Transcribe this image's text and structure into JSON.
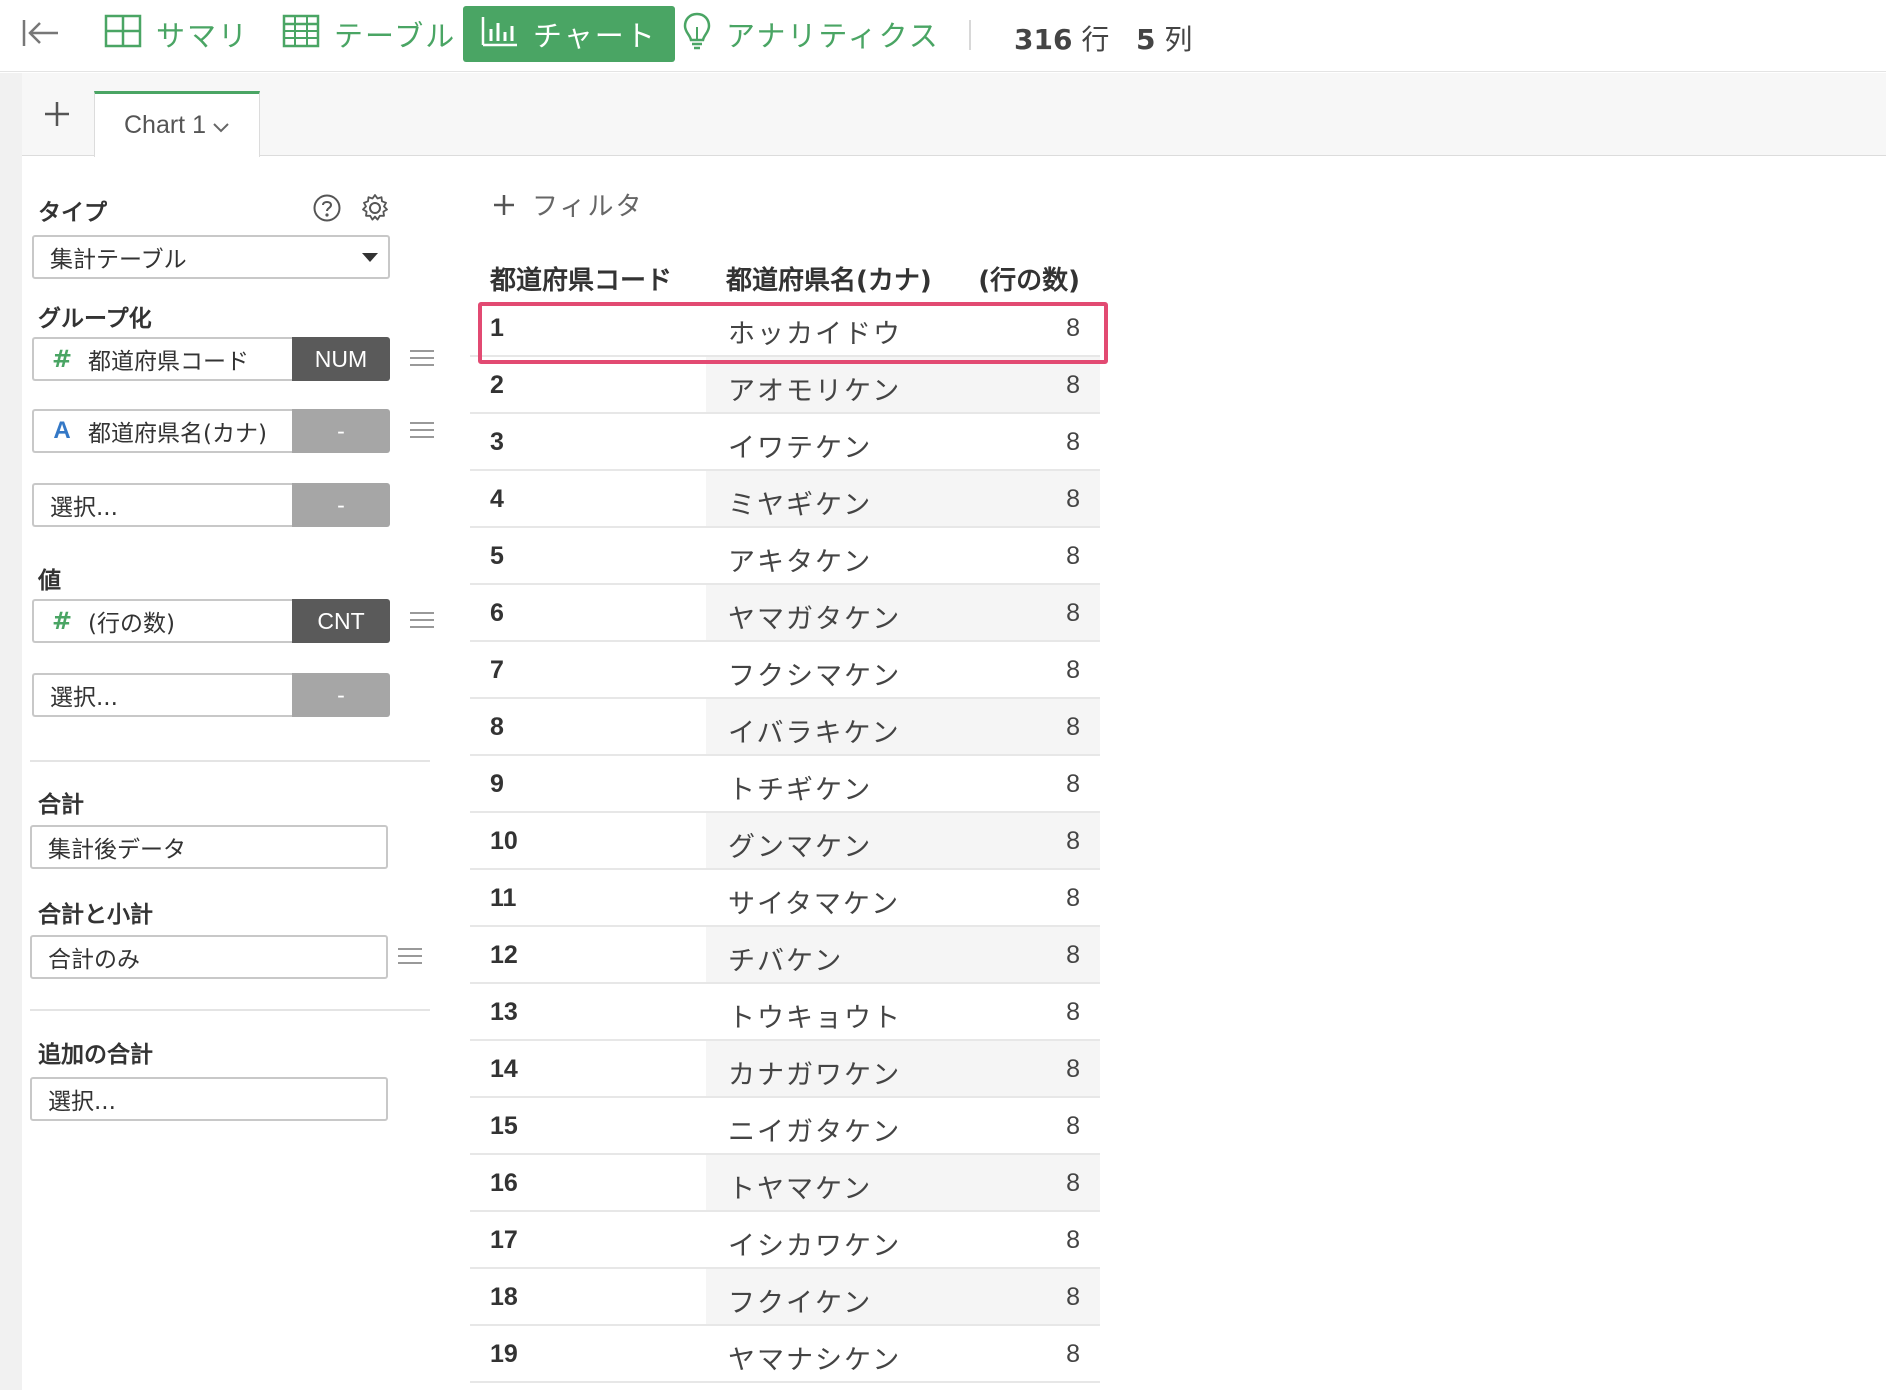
{
  "toolbar": {
    "tabs": [
      {
        "label": "サマリ",
        "icon": "grid-icon"
      },
      {
        "label": "テーブル",
        "icon": "table-icon"
      },
      {
        "label": "チャート",
        "icon": "bar-chart-icon",
        "active": true
      },
      {
        "label": "アナリティクス",
        "icon": "lightbulb-icon"
      }
    ],
    "rows_value": "316",
    "rows_unit": "行",
    "cols_value": "5",
    "cols_unit": "列",
    "accent_color": "#4aa564"
  },
  "chart_tabs": {
    "add_icon": "plus-icon",
    "current": "Chart 1"
  },
  "config": {
    "type_label": "タイプ",
    "type_value": "集計テーブル",
    "group_label": "グループ化",
    "group_fields": [
      {
        "type": "#",
        "name": "都道府県コード",
        "agg": "NUM"
      },
      {
        "type": "A",
        "name": "都道府県名(カナ)",
        "agg": "-"
      },
      {
        "type": "",
        "name": "選択...",
        "agg": "-"
      }
    ],
    "value_label": "値",
    "value_fields": [
      {
        "type": "#",
        "name": "(行の数)",
        "agg": "CNT"
      },
      {
        "type": "",
        "name": "選択...",
        "agg": "-"
      }
    ],
    "total_label": "合計",
    "total_value": "集計後データ",
    "subtotal_label": "合計と小計",
    "subtotal_value": "合計のみ",
    "extra_total_label": "追加の合計",
    "extra_total_value": "選択..."
  },
  "filter": {
    "label": "フィルタ"
  },
  "table": {
    "headers": [
      "都道府県コード",
      "都道府県名(カナ)",
      "(行の数)"
    ],
    "rows": [
      [
        "1",
        "ホッカイドウ",
        "8"
      ],
      [
        "2",
        "アオモリケン",
        "8"
      ],
      [
        "3",
        "イワテケン",
        "8"
      ],
      [
        "4",
        "ミヤギケン",
        "8"
      ],
      [
        "5",
        "アキタケン",
        "8"
      ],
      [
        "6",
        "ヤマガタケン",
        "8"
      ],
      [
        "7",
        "フクシマケン",
        "8"
      ],
      [
        "8",
        "イバラキケン",
        "8"
      ],
      [
        "9",
        "トチギケン",
        "8"
      ],
      [
        "10",
        "グンマケン",
        "8"
      ],
      [
        "11",
        "サイタマケン",
        "8"
      ],
      [
        "12",
        "チバケン",
        "8"
      ],
      [
        "13",
        "トウキョウト",
        "8"
      ],
      [
        "14",
        "カナガワケン",
        "8"
      ],
      [
        "15",
        "ニイガタケン",
        "8"
      ],
      [
        "16",
        "トヤマケン",
        "8"
      ],
      [
        "17",
        "イシカワケン",
        "8"
      ],
      [
        "18",
        "フクイケン",
        "8"
      ],
      [
        "19",
        "ヤマナシケン",
        "8"
      ]
    ],
    "highlight_color": "#e24a72"
  }
}
